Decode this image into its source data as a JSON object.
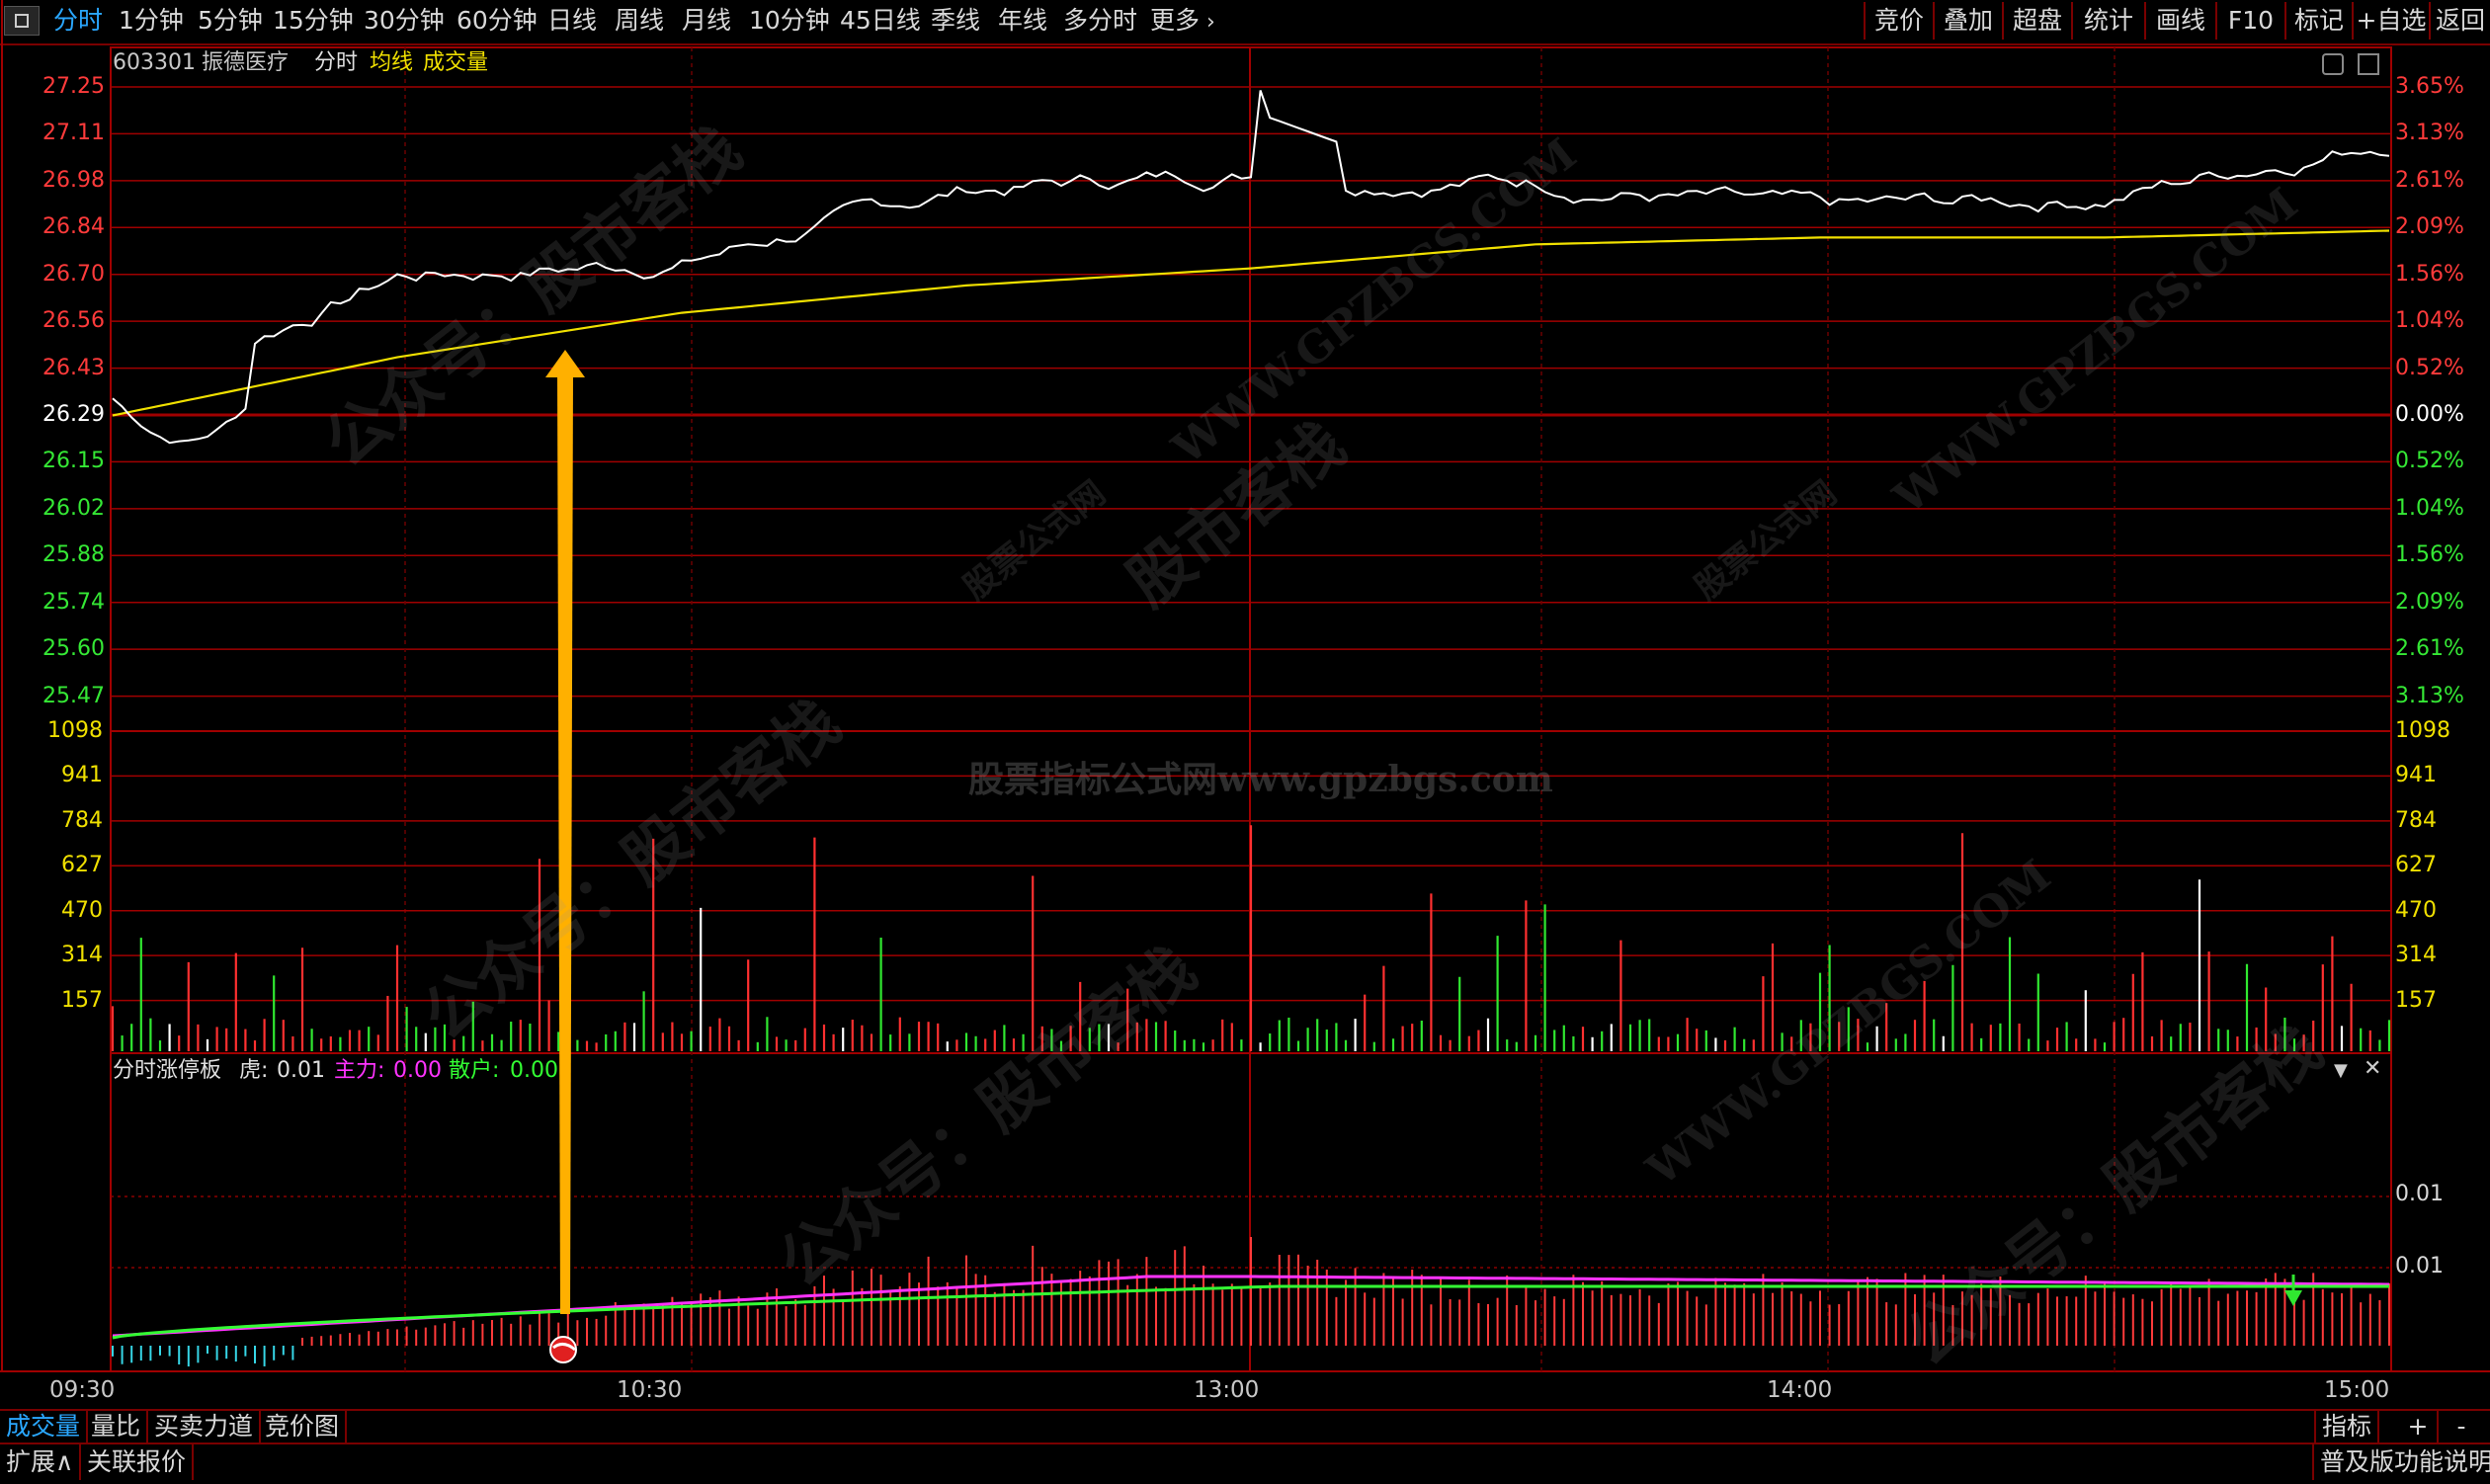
{
  "toolbar": {
    "periods": [
      "分时",
      "1分钟",
      "5分钟",
      "15分钟",
      "30分钟",
      "60分钟",
      "日线",
      "周线",
      "月线",
      "10分钟",
      "45日线",
      "季线",
      "年线",
      "多分时",
      "更多"
    ],
    "right_buttons": [
      "竞价",
      "叠加",
      "超盘",
      "统计",
      "画线",
      "F10",
      "标记",
      "+自选",
      "返回"
    ]
  },
  "header": {
    "code": "603301",
    "name": "振德医疗",
    "mode": "分时",
    "avg_label": "均线",
    "vol_label": "成交量"
  },
  "price_axis": {
    "left": [
      "27.25",
      "27.11",
      "26.98",
      "26.84",
      "26.70",
      "26.56",
      "26.43",
      "26.29",
      "26.15",
      "26.02",
      "25.88",
      "25.74",
      "25.60",
      "25.47"
    ],
    "right": [
      "3.65%",
      "3.13%",
      "2.61%",
      "2.09%",
      "1.56%",
      "1.04%",
      "0.52%",
      "0.00%",
      "0.52%",
      "1.04%",
      "1.56%",
      "2.09%",
      "2.61%",
      "3.13%"
    ]
  },
  "volume_axis": [
    "1098",
    "941",
    "784",
    "627",
    "470",
    "314",
    "157"
  ],
  "indicator": {
    "title": "分时涨停板",
    "hu_label": "虎:",
    "hu_value": "0.01",
    "zhuli_label": "主力:",
    "zhuli_value": "0.00",
    "sanhu_label": "散户:",
    "sanhu_value": "0.00",
    "axis": [
      "0.01",
      "0.01"
    ]
  },
  "time_axis": [
    "09:30",
    "10:30",
    "13:00",
    "14:00",
    "15:00"
  ],
  "bottom_tabs": [
    "成交量",
    "量比",
    "买卖力道",
    "竞价图"
  ],
  "bottom_right": [
    "指标",
    "+",
    "-"
  ],
  "bottom_bar": {
    "expand": "扩展∧",
    "related": "关联报价",
    "help": "普及版功能说明"
  },
  "watermarks": [
    "股市客栈",
    "公众号：股市客栈",
    "WWW.GPZBGS.COM",
    "股票公式网",
    "股票指标公式网www.gpzbgs.com"
  ],
  "colors": {
    "price_line": "#ffffff",
    "avg_line": "#f0e000",
    "grid_red": "#a00000",
    "up_text": "#ff3b3b",
    "down_text": "#35e835",
    "vol_text": "#f0e000",
    "zhuli": "#ff33ff",
    "sanhu": "#33ff33",
    "arrow": "#ffb000"
  },
  "chart_data": {
    "type": "line",
    "prev_close": 26.29,
    "x": [
      "09:30",
      "10:00",
      "10:30",
      "11:00",
      "11:30/13:00",
      "13:30",
      "14:00",
      "14:30",
      "15:00"
    ],
    "series": [
      {
        "values": [
          26.34,
          26.7,
          26.74,
          26.95,
          27.0,
          26.98,
          26.88,
          26.93,
          27.1
        ]
      },
      {
        "values": [
          26.29,
          26.46,
          26.59,
          26.67,
          26.72,
          26.79,
          26.81,
          26.81,
          26.83
        ]
      }
    ],
    "volume_ylim": [
      0,
      1098
    ],
    "price_ylim": [
      25.47,
      27.25
    ]
  }
}
